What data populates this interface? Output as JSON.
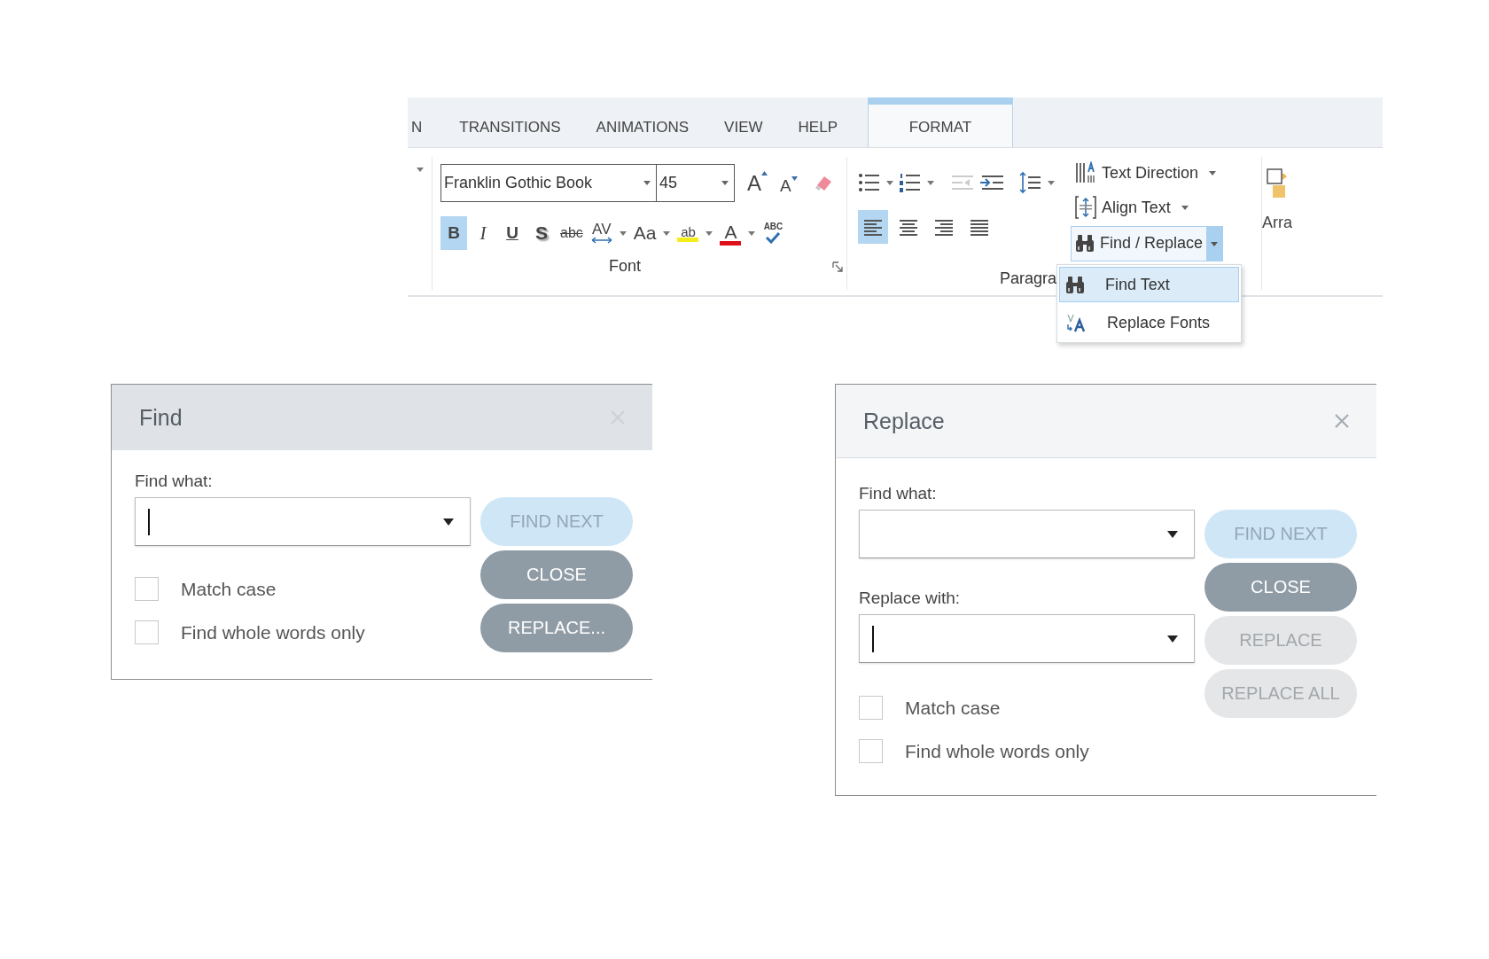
{
  "ribbon": {
    "tabs": [
      {
        "label": "N",
        "selected": false
      },
      {
        "label": "TRANSITIONS",
        "selected": false
      },
      {
        "label": "ANIMATIONS",
        "selected": false
      },
      {
        "label": "VIEW",
        "selected": false
      },
      {
        "label": "HELP",
        "selected": false
      },
      {
        "label": "FORMAT",
        "selected": true
      }
    ],
    "font_group": {
      "label": "Font",
      "font_name": "Franklin Gothic Book",
      "font_size": "45",
      "size_buttons": [
        {
          "glyph": "A",
          "kind": "grow"
        },
        {
          "glyph": "A",
          "kind": "shrink"
        }
      ],
      "format_buttons": [
        {
          "glyph": "B",
          "kind": "bold",
          "selected": true,
          "dropdown": false
        },
        {
          "glyph": "I",
          "kind": "italic",
          "selected": false,
          "dropdown": false
        },
        {
          "glyph": "U",
          "kind": "underline",
          "selected": false,
          "dropdown": false
        },
        {
          "glyph": "S",
          "kind": "shadow",
          "selected": false,
          "dropdown": false
        },
        {
          "glyph": "abc",
          "kind": "strike",
          "selected": false,
          "dropdown": false
        },
        {
          "glyph": "AV",
          "kind": "spacing",
          "selected": false,
          "dropdown": true
        },
        {
          "glyph": "Aa",
          "kind": "case",
          "selected": false,
          "dropdown": true
        },
        {
          "glyph": "ab",
          "kind": "highlight",
          "selected": false,
          "dropdown": true
        },
        {
          "glyph": "A",
          "kind": "color",
          "selected": false,
          "dropdown": true
        },
        {
          "glyph": "ABC",
          "kind": "spelling",
          "selected": false,
          "dropdown": false
        }
      ]
    },
    "paragraph_group": {
      "label": "Paragra",
      "alignment_buttons": [
        {
          "kind": "left",
          "selected": true
        },
        {
          "kind": "center",
          "selected": false
        },
        {
          "kind": "right",
          "selected": false
        },
        {
          "kind": "justify",
          "selected": false
        }
      ],
      "commands": [
        {
          "label": "Text Direction",
          "kind": "text-direction",
          "expanded": false
        },
        {
          "label": "Align Text",
          "kind": "align-text",
          "expanded": false
        },
        {
          "label": "Find / Replace",
          "kind": "find-replace",
          "expanded": true
        }
      ]
    },
    "arrange_group": {
      "label": "Arra"
    },
    "menu": [
      {
        "label": "Find Text",
        "kind": "find",
        "selected": true
      },
      {
        "label": "Replace Fonts",
        "kind": "replace-fonts",
        "selected": false
      }
    ]
  },
  "find_dialog": {
    "title": "Find",
    "fields": [
      {
        "label": "Find what:",
        "focused": true
      }
    ],
    "checkboxes": [
      {
        "label": "Match case",
        "checked": false
      },
      {
        "label": "Find whole words only",
        "checked": false
      }
    ],
    "buttons": [
      {
        "label": "FIND NEXT",
        "kind": "accent"
      },
      {
        "label": "CLOSE",
        "kind": "dark"
      },
      {
        "label": "REPLACE...",
        "kind": "dark"
      }
    ]
  },
  "replace_dialog": {
    "title": "Replace",
    "fields": [
      {
        "label": "Find what:",
        "focused": false
      },
      {
        "label": "Replace with:",
        "focused": true
      }
    ],
    "checkboxes": [
      {
        "label": "Match case",
        "checked": false
      },
      {
        "label": "Find whole words only",
        "checked": false
      }
    ],
    "buttons": [
      {
        "label": "FIND NEXT",
        "kind": "accent"
      },
      {
        "label": "CLOSE",
        "kind": "dark"
      },
      {
        "label": "REPLACE",
        "kind": "muted"
      },
      {
        "label": "REPLACE ALL",
        "kind": "muted"
      }
    ]
  }
}
